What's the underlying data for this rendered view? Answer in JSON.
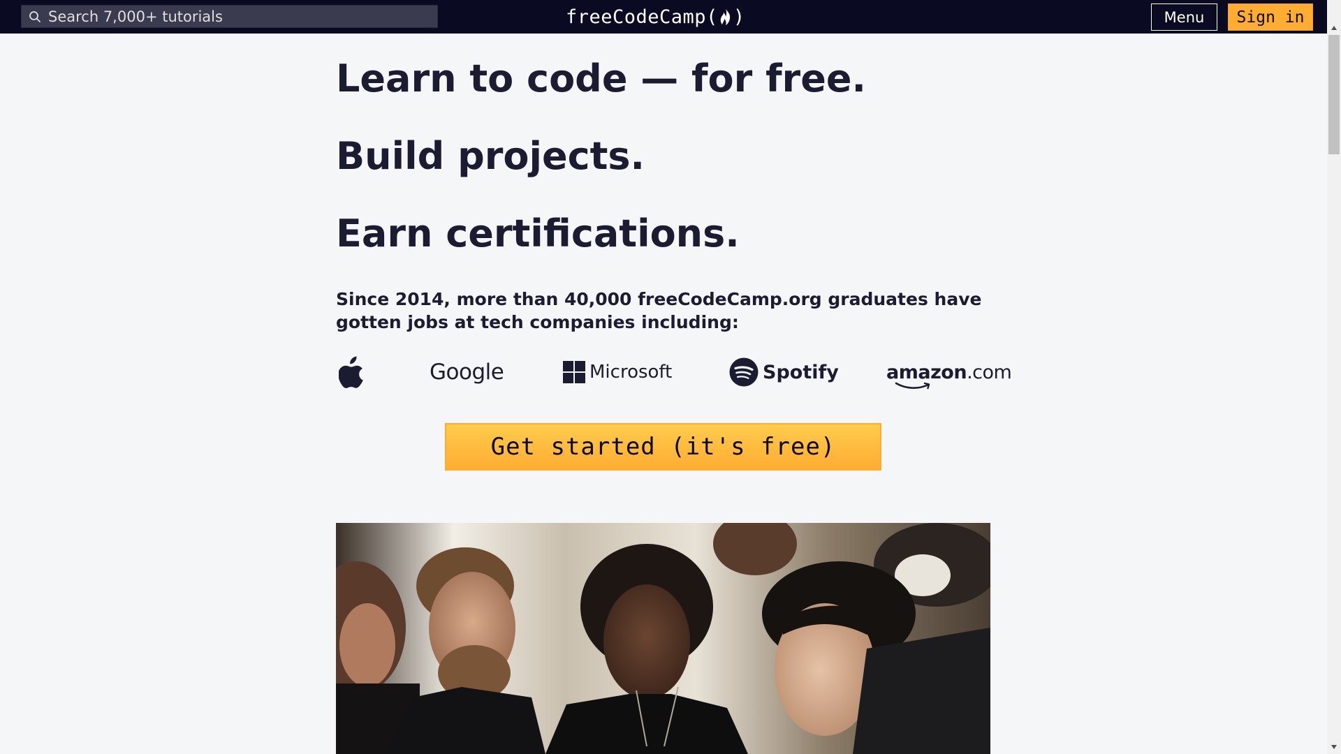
{
  "nav": {
    "search_placeholder": "Search 7,000+ tutorials",
    "brand": "freeCodeCamp",
    "brand_open": "(",
    "brand_close": ")",
    "menu_label": "Menu",
    "signin_label": "Sign in"
  },
  "hero": {
    "headline_1": "Learn to code — for free.",
    "headline_2": "Build projects.",
    "headline_3": "Earn certifications.",
    "since_text": "Since 2014, more than 40,000 freeCodeCamp.org graduates have gotten jobs at tech companies including:",
    "cta_label": "Get started (it's free)"
  },
  "companies": {
    "apple": "Apple",
    "google": "Google",
    "microsoft": "Microsoft",
    "spotify": "Spotify",
    "amazon_main": "amazon",
    "amazon_suffix": ".com"
  },
  "icons": {
    "search": "search-icon",
    "flame": "flame-icon",
    "scroll_up": "scroll-up-arrow-icon",
    "scroll_down": "scroll-down-arrow-icon"
  },
  "colors": {
    "nav_bg": "#0a0a23",
    "page_bg": "#f5f6f7",
    "accent": "#feac32",
    "text": "#1b1b32"
  }
}
